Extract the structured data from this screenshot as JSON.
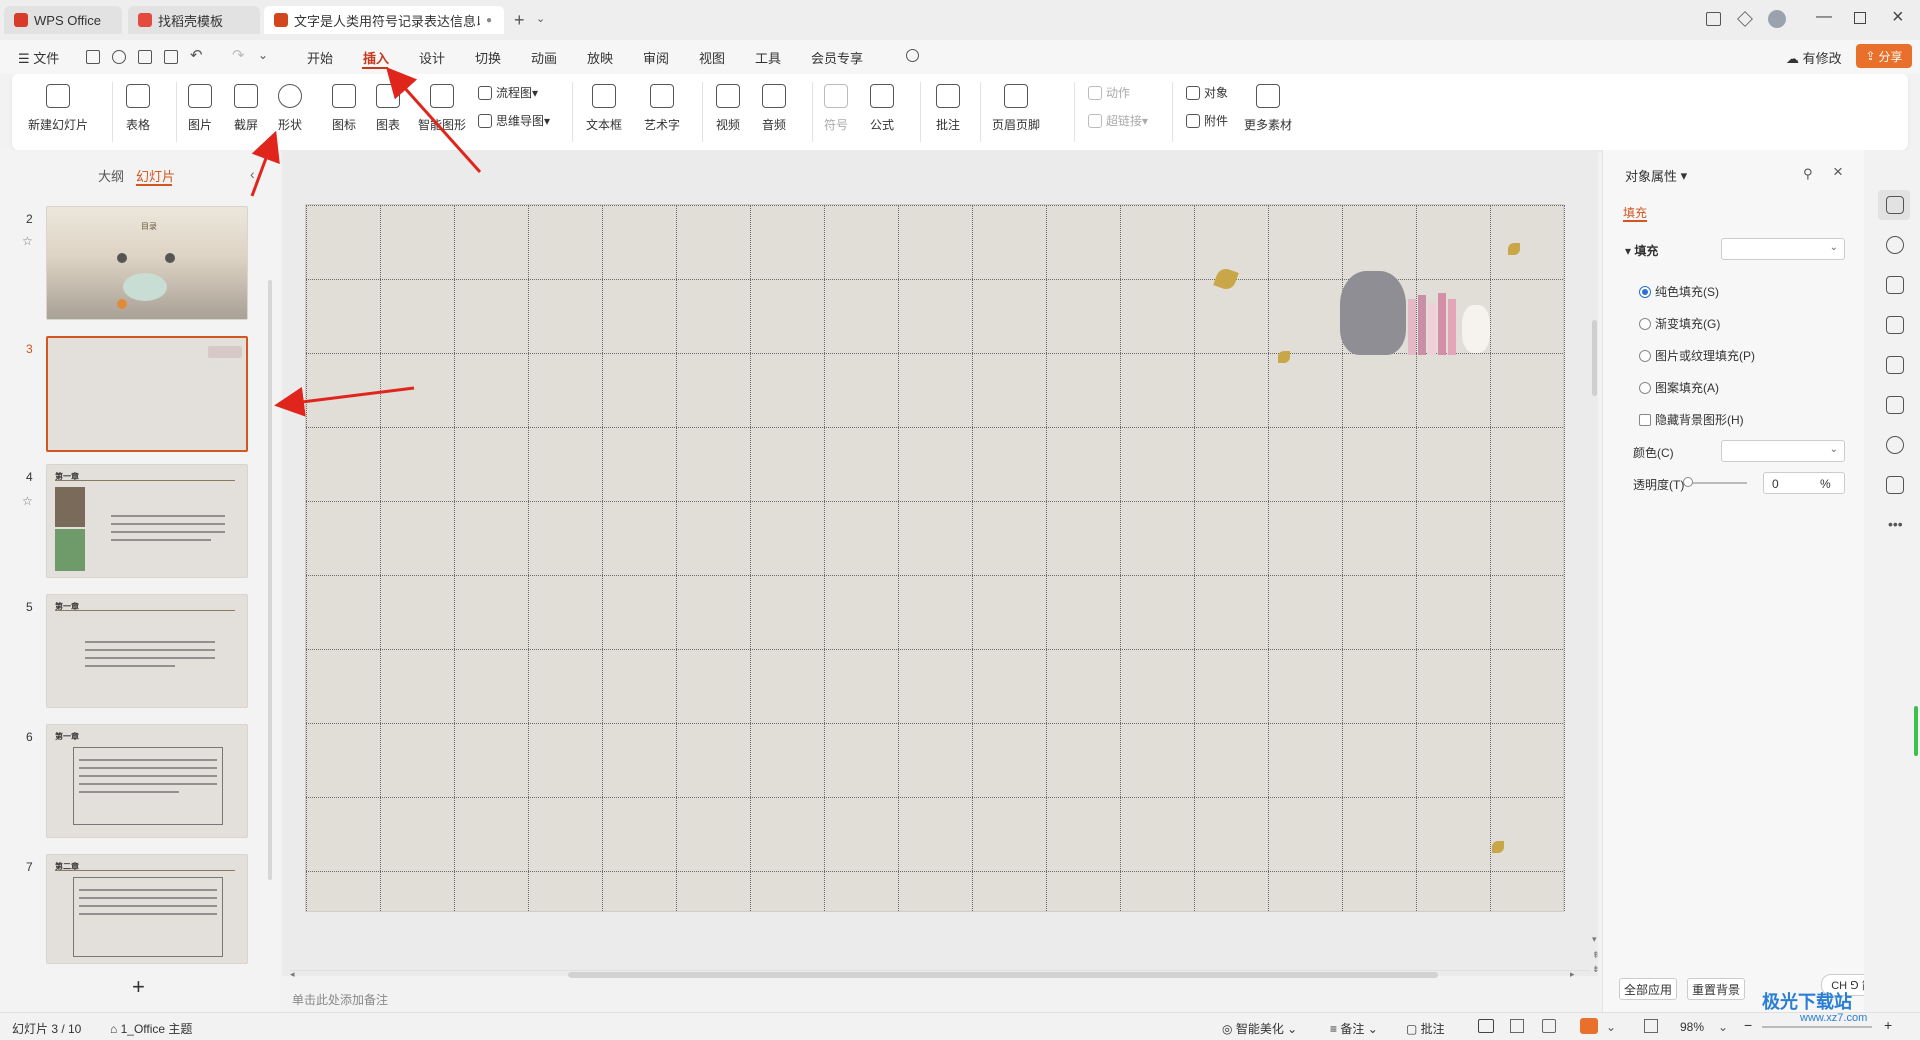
{
  "tabs": [
    {
      "label": "WPS Office",
      "icon": "wps-logo-icon"
    },
    {
      "label": "找稻壳模板",
      "icon": "docer-icon"
    },
    {
      "label": "文字是人类用符号记录表达信息以",
      "icon": "ppt-icon"
    }
  ],
  "menu": {
    "file": "文件",
    "items": [
      "开始",
      "插入",
      "设计",
      "切换",
      "动画",
      "放映",
      "审阅",
      "视图",
      "工具",
      "会员专享"
    ],
    "active": "插入",
    "modified": "有修改",
    "share": "分享"
  },
  "ribbon": {
    "new_slide": "新建幻灯片",
    "table": "表格",
    "picture": "图片",
    "screenshot": "截屏",
    "shape": "形状",
    "icon": "图标",
    "chart": "图表",
    "smartart": "智能图形",
    "flowchart": "流程图",
    "mindmap": "思维导图",
    "textbox": "文本框",
    "wordart": "艺术字",
    "video": "视频",
    "audio": "音频",
    "symbol": "符号",
    "formula": "公式",
    "comment": "批注",
    "header_footer": "页眉页脚",
    "action": "动作",
    "hyperlink": "超链接",
    "object": "对象",
    "attachment": "附件",
    "more": "更多素材"
  },
  "left_panel": {
    "tab_outline": "大纲",
    "tab_slides": "幻灯片",
    "slides": [
      {
        "num": "2",
        "title": "目录",
        "starred": true
      },
      {
        "num": "3",
        "title": "",
        "selected": true
      },
      {
        "num": "4",
        "title": "第一章",
        "starred": true
      },
      {
        "num": "5",
        "title": "第一章"
      },
      {
        "num": "6",
        "title": "第一章"
      },
      {
        "num": "7",
        "title": "第二章"
      }
    ],
    "add": "+"
  },
  "notes_placeholder": "单击此处添加备注",
  "right_panel": {
    "title": "对象属性",
    "tab": "填充",
    "section": "填充",
    "options": [
      "纯色填充(S)",
      "渐变填充(G)",
      "图片或纹理填充(P)",
      "图案填充(A)"
    ],
    "hide_bg": "隐藏背景图形(H)",
    "color_label": "颜色(C)",
    "transparency_label": "透明度(T)",
    "transparency_value": "0",
    "percent": "%",
    "apply_all": "全部应用",
    "reset_bg": "重置背景"
  },
  "ime": "CH ⅁ 简",
  "status": {
    "slide_info": "幻灯片 3 / 10",
    "theme": "1_Office 主题",
    "beautify": "智能美化",
    "notes": "备注",
    "comment": "批注",
    "zoom": "98%"
  },
  "watermark": "极光下载站",
  "watermark_url": "www.xz7.com",
  "colors": {
    "accent": "#c53a1c",
    "share_bg": "#e8702a",
    "selected_border": "#d2561f",
    "radio": "#2a6fd6"
  }
}
